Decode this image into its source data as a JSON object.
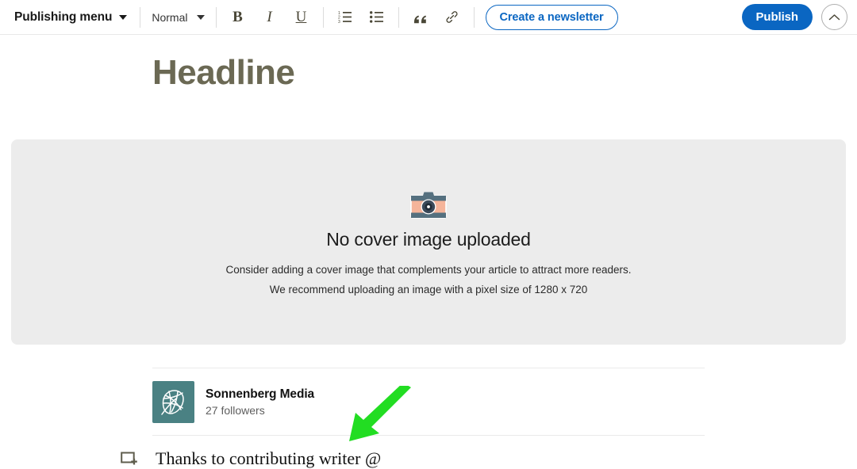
{
  "toolbar": {
    "publishing_menu_label": "Publishing menu",
    "text_style_label": "Normal",
    "bold_label": "B",
    "italic_label": "I",
    "underline_label": "U",
    "ordered_list_name": "numbered-list",
    "bullet_list_name": "bulleted-list",
    "quote_label": "”",
    "link_name": "link",
    "newsletter_label": "Create a newsletter",
    "publish_label": "Publish",
    "collapse_name": "chevron-up"
  },
  "article": {
    "headline": "Headline",
    "headline_color": "#6b6954"
  },
  "cover": {
    "title": "No cover image uploaded",
    "line1": "Consider adding a cover image that complements your article to attract more readers.",
    "line2": "We recommend uploading an image with a pixel size of 1280 x 720",
    "background_color": "#ececec",
    "icon": "camera-icon"
  },
  "author": {
    "name": "Sonnenberg Media",
    "followers": "27 followers",
    "avatar_color": "#4a8183",
    "avatar_icon": "leaf-globe-logo"
  },
  "body": {
    "add_block_icon": "add-block-icon",
    "paragraph": "Thanks to contributing writer @"
  },
  "annotation": {
    "arrow_color": "#22dd22",
    "arrow_direction": "down-left"
  },
  "colors": {
    "brand_blue": "#0a66c2",
    "camera_body": "#f5b49a",
    "camera_band": "#55707f"
  }
}
